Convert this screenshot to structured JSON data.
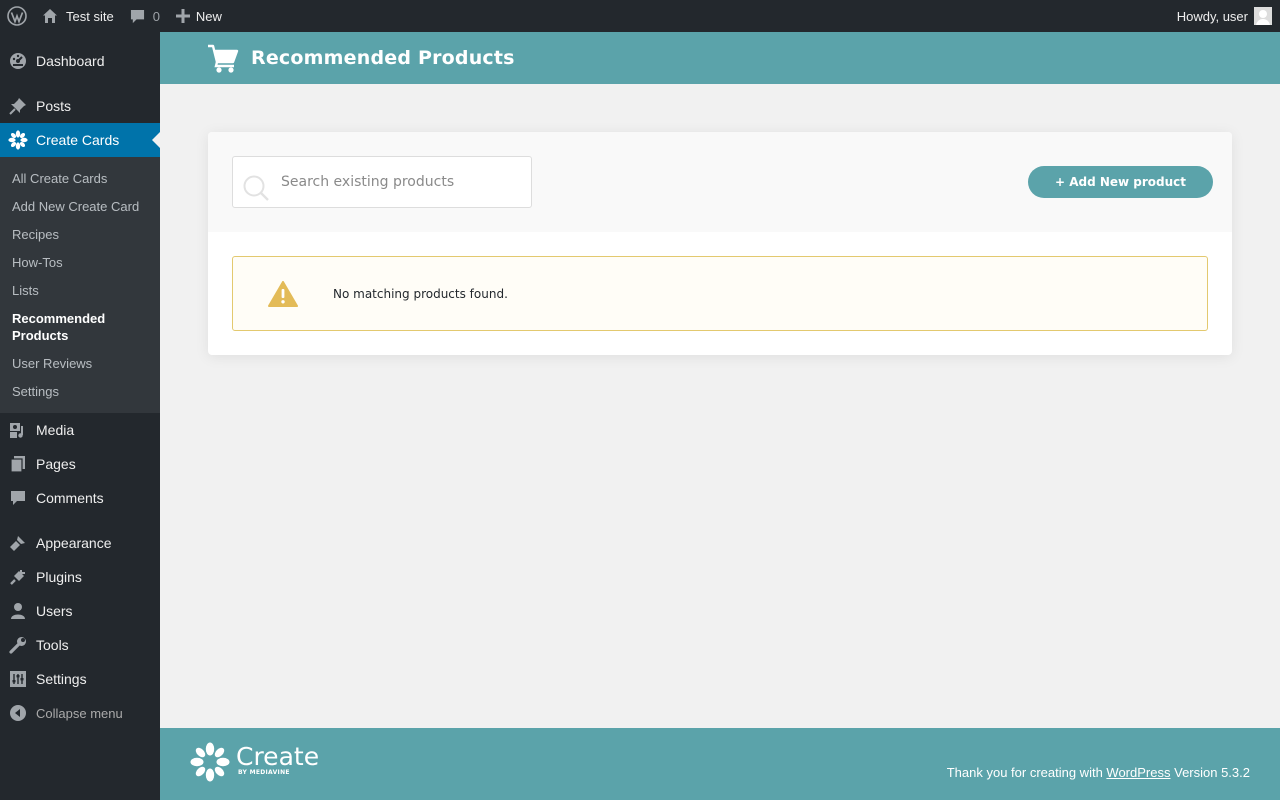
{
  "adminbar": {
    "site_name": "Test site",
    "comments_count": "0",
    "new_label": "New",
    "greeting": "Howdy, user"
  },
  "sidebar": {
    "items": [
      {
        "label": "Dashboard",
        "icon": "dashboard-icon"
      },
      {
        "label": "Posts",
        "icon": "pin-icon"
      },
      {
        "label": "Create Cards",
        "icon": "flower-icon"
      },
      {
        "label": "Media",
        "icon": "media-icon"
      },
      {
        "label": "Pages",
        "icon": "pages-icon"
      },
      {
        "label": "Comments",
        "icon": "comment-icon"
      },
      {
        "label": "Appearance",
        "icon": "brush-icon"
      },
      {
        "label": "Plugins",
        "icon": "plug-icon"
      },
      {
        "label": "Users",
        "icon": "user-icon"
      },
      {
        "label": "Tools",
        "icon": "wrench-icon"
      },
      {
        "label": "Settings",
        "icon": "sliders-icon"
      }
    ],
    "submenu": [
      "All Create Cards",
      "Add New Create Card",
      "Recipes",
      "How-Tos",
      "Lists",
      "Recommended Products",
      "User Reviews",
      "Settings"
    ],
    "collapse_label": "Collapse menu"
  },
  "header": {
    "title": "Recommended Products",
    "icon": "cart-icon"
  },
  "main": {
    "search_placeholder": "Search existing products",
    "add_button_label": "+ Add New product",
    "notice_text": "No matching products found."
  },
  "footer": {
    "logo_word": "Create",
    "logo_by": "BY MEDIAVINE",
    "text_prefix": "Thank you for creating with",
    "link_text": "WordPress",
    "version": "Version 5.3.2"
  },
  "colors": {
    "admin_dark": "#23282d",
    "menu_active": "#0073aa",
    "brand_teal": "#5ba3aa",
    "warning": "#e3bb58"
  }
}
